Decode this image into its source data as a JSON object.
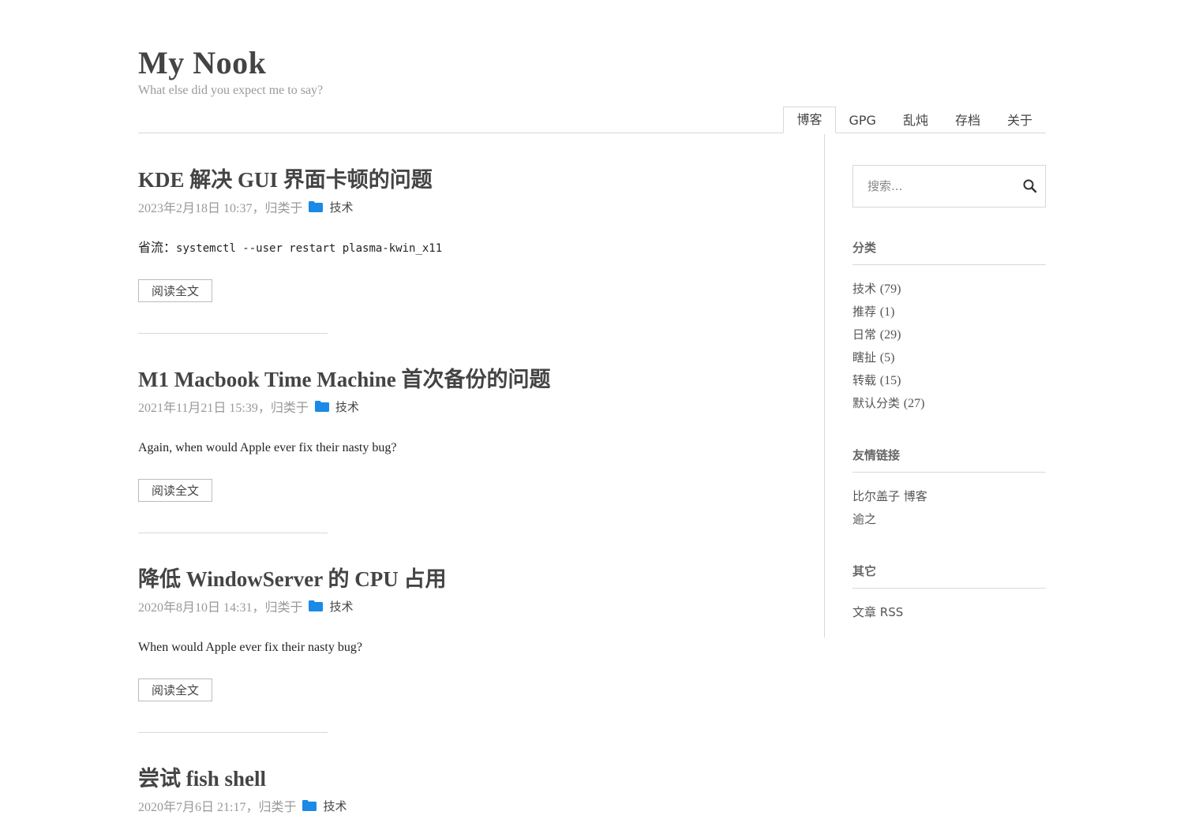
{
  "site": {
    "title": "My Nook",
    "description": "What else did you expect me to say?"
  },
  "nav": [
    {
      "label": "博客",
      "active": true
    },
    {
      "label": "GPG"
    },
    {
      "label": "乱炖"
    },
    {
      "label": "存档"
    },
    {
      "label": "关于"
    }
  ],
  "posts": [
    {
      "title": "KDE 解决 GUI 界面卡顿的问题",
      "date": "2023年2月18日 10:37，",
      "filed_under": "归类于",
      "category": "技术",
      "excerpt_prefix": "省流：",
      "excerpt_code": "systemctl --user restart plasma-kwin_x11",
      "read_more": "阅读全文"
    },
    {
      "title": "M1 Macbook Time Machine 首次备份的问题",
      "date": "2021年11月21日 15:39，",
      "filed_under": "归类于",
      "category": "技术",
      "excerpt": "Again, when would Apple ever fix their nasty bug?",
      "read_more": "阅读全文"
    },
    {
      "title": "降低 WindowServer 的 CPU 占用",
      "date": "2020年8月10日 14:31，",
      "filed_under": "归类于",
      "category": "技术",
      "excerpt": "When would Apple ever fix their nasty bug?",
      "read_more": "阅读全文"
    },
    {
      "title": "尝试 fish shell",
      "date": "2020年7月6日 21:17，",
      "filed_under": "归类于",
      "category": "技术"
    }
  ],
  "sidebar": {
    "search_placeholder": "搜索...",
    "categories": {
      "title": "分类",
      "items": [
        {
          "name": "技术",
          "count": "(79)"
        },
        {
          "name": "推荐",
          "count": "(1)"
        },
        {
          "name": "日常",
          "count": "(29)"
        },
        {
          "name": "瞎扯",
          "count": "(5)"
        },
        {
          "name": "转载",
          "count": "(15)"
        },
        {
          "name": "默认分类",
          "count": "(27)"
        }
      ]
    },
    "links": {
      "title": "友情链接",
      "items": [
        "比尔盖子 博客",
        "逾之"
      ]
    },
    "other": {
      "title": "其它",
      "items": [
        "文章 RSS"
      ]
    }
  },
  "colors": {
    "folder_icon": "#1a8ae6",
    "text": "#444444",
    "muted": "#999999",
    "border": "#d8d8d8"
  }
}
